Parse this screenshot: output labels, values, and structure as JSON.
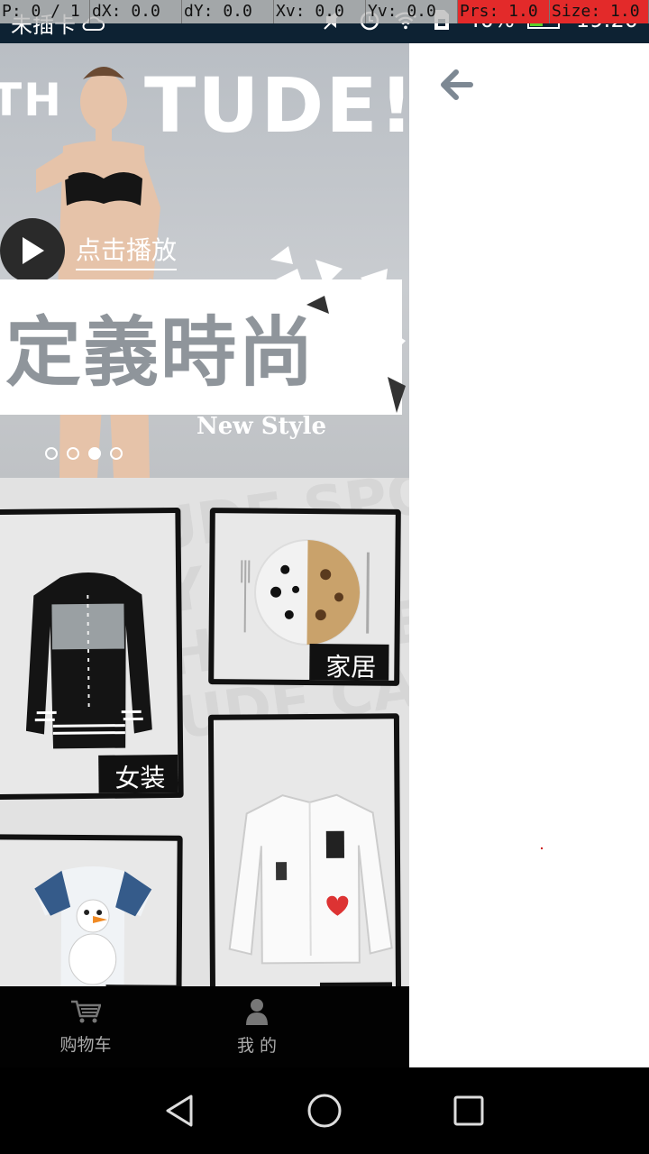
{
  "debug": {
    "pointer": "P: 0 / 1",
    "dx": "dX: 0.0",
    "dy": "dY: 0.0",
    "xv": "Xv: 0.0",
    "yv": "Yv: 0.0",
    "prs": "Prs: 1.0",
    "size": "Size: 1.0"
  },
  "status_bar": {
    "carrier": "未插卡",
    "battery": "40%",
    "time": "19:20",
    "icons": [
      "cloud-icon",
      "mute-icon",
      "alarm-icon",
      "wifi-icon",
      "sim-icon",
      "battery-icon"
    ],
    "bg_color": "#0d2233"
  },
  "banner": {
    "headline": "TUDE!",
    "headline_left": "TH",
    "play_label": "点击播放",
    "title": "定義時尚",
    "subtitle": "New Style",
    "page_count": 4,
    "active_page": 2
  },
  "categories": [
    {
      "label": "家居",
      "icon": "plate-icon"
    },
    {
      "label": "女装",
      "icon": "jacket-icon"
    },
    {
      "label": "",
      "icon": "shirt-icon"
    },
    {
      "label": "",
      "icon": "kids-top-icon"
    }
  ],
  "tabs": [
    {
      "label": "购物车",
      "icon": "cart-icon"
    },
    {
      "label": "我 的",
      "icon": "user-icon"
    }
  ],
  "colors": {
    "panel_bg": "#e3e3e3",
    "tabbar_bg": "#020202",
    "tab_text": "#aaaaaa",
    "back_arrow": "#7d8893"
  }
}
